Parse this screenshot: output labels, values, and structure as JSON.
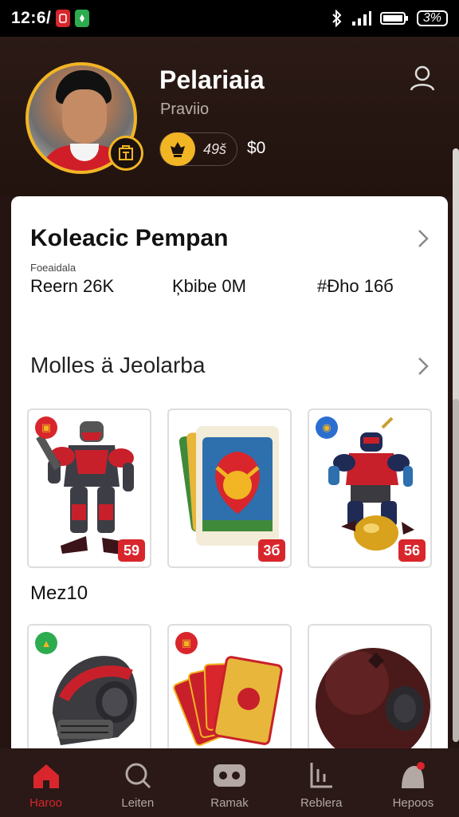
{
  "status_bar": {
    "time": "12:6/",
    "battery": "3%"
  },
  "profile": {
    "name": "Pelariaia",
    "subtitle": "Praviio",
    "points": "49š",
    "coins": "$0"
  },
  "collection": {
    "title": "Koleacic Pempan",
    "caption": "Foeaidala",
    "stats": [
      "Reern 26K",
      "Ķbibe 0M",
      "#Đho 16б"
    ]
  },
  "featured": {
    "title": "Molles ä Jeolarba",
    "row_label": "Mez10",
    "items": [
      {
        "name": "robot-warrior",
        "price": "59",
        "badge_color": "#d8262c"
      },
      {
        "name": "poster-card",
        "price": "3б",
        "badge_color": ""
      },
      {
        "name": "armored-knight",
        "price": "56",
        "badge_color": "#2a6fd0"
      },
      {
        "name": "helmet",
        "price": "",
        "badge_color": "#2dab4f"
      },
      {
        "name": "playing-cards",
        "price": "",
        "badge_color": "#d8262c"
      },
      {
        "name": "sphere-orb",
        "price": "",
        "badge_color": ""
      }
    ]
  },
  "nav": [
    {
      "label": "Haroo",
      "icon": "home-icon",
      "active": true
    },
    {
      "label": "Leiten",
      "icon": "search-icon",
      "active": false
    },
    {
      "label": "Ramak",
      "icon": "controller-icon",
      "active": false
    },
    {
      "label": "Reblera",
      "icon": "chart-icon",
      "active": false
    },
    {
      "label": "Hepoos",
      "icon": "hood-icon",
      "active": false
    }
  ],
  "colors": {
    "accent": "#d8262c",
    "gold": "#f2b523",
    "header_bg": "#241512"
  }
}
